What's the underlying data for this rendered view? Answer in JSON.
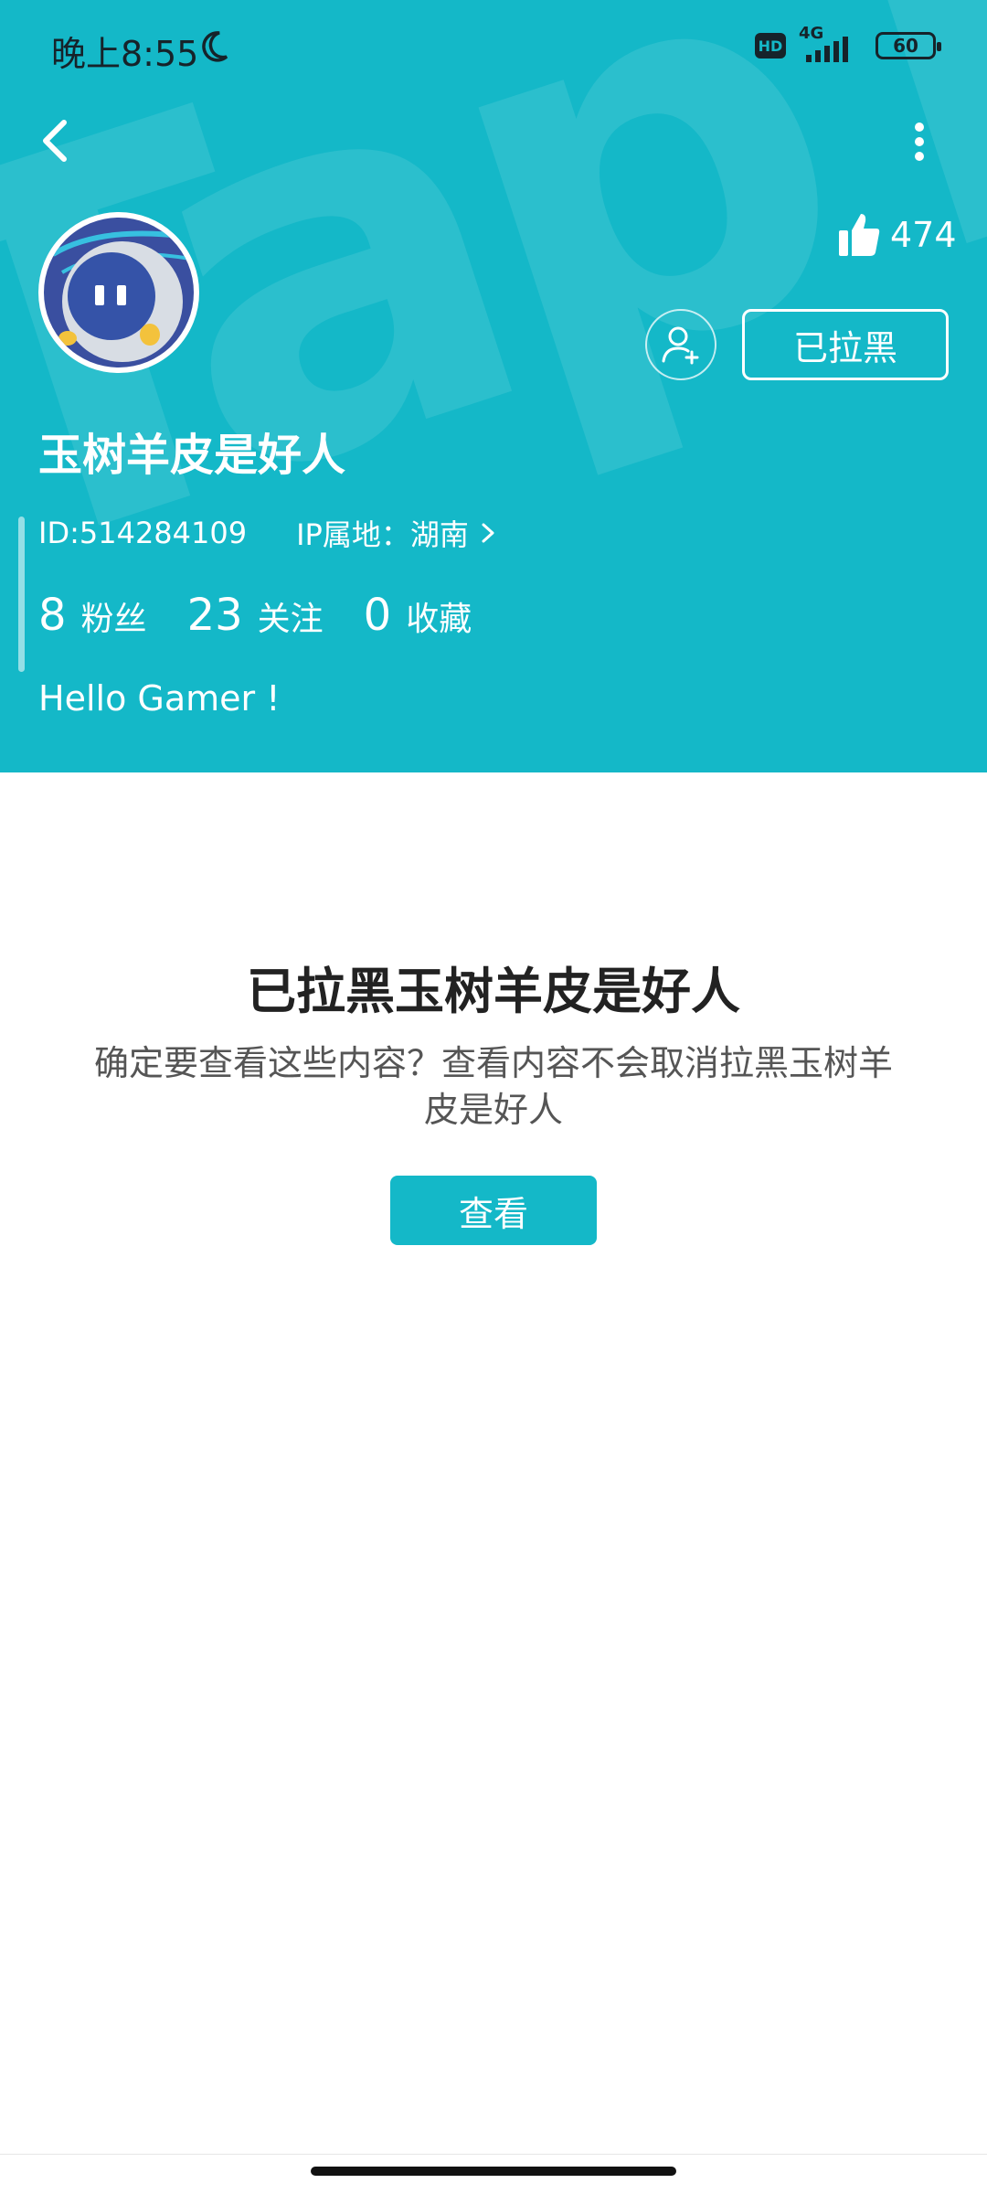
{
  "status_bar": {
    "time": "晚上8:55",
    "hd": "HD",
    "network": "4G",
    "battery": "60"
  },
  "header": {
    "watermark": "TapTap",
    "likes": "474",
    "blocked_label": "已拉黑",
    "username": "玉树羊皮是好人",
    "id_text": "ID:514284109",
    "ip_text": "IP属地：湖南",
    "stats": [
      {
        "value": "8",
        "label": "粉丝"
      },
      {
        "value": "23",
        "label": "关注"
      },
      {
        "value": "0",
        "label": "收藏"
      }
    ],
    "bio": "Hello Gamer !",
    "colors": {
      "background": "#14b8c8"
    }
  },
  "blocked_notice": {
    "title": "已拉黑玉树羊皮是好人",
    "description": "确定要查看这些内容？查看内容不会取消拉黑玉树羊皮是好人",
    "view_button": "查看"
  },
  "icons": [
    "moon-icon",
    "back-icon",
    "more-icon",
    "like-icon",
    "add-friend-icon",
    "chevron-right-icon"
  ]
}
